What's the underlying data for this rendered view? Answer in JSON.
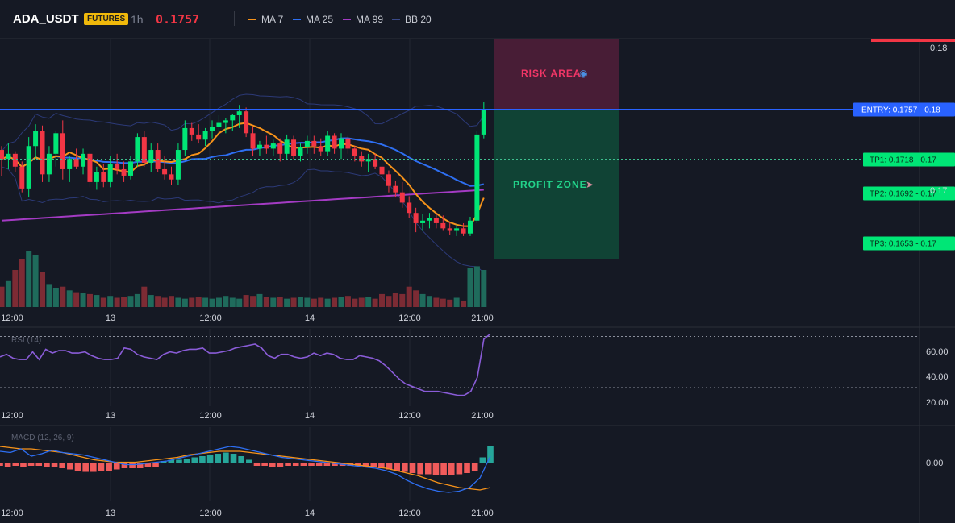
{
  "header": {
    "symbol": "ADA_USDT",
    "badge": "FUTURES",
    "timeframe": "1h",
    "price": "0.1757",
    "legend": [
      {
        "name": "MA 7",
        "color": "#f7931a"
      },
      {
        "name": "MA 25",
        "color": "#2e6ff2"
      },
      {
        "name": "MA 99",
        "color": "#a43bc4"
      },
      {
        "name": "BB 20",
        "color": "#3a4a8a"
      }
    ]
  },
  "overlays": {
    "risk_label": "RISK AREA",
    "profit_label": "PROFIT ZONE",
    "risk_icon": "shield-icon",
    "profit_icon": "rocket-icon"
  },
  "levels": [
    {
      "label": "ENTRY: 0.1757",
      "value": "0.18",
      "price": 0.1757,
      "color": "#2962ff"
    },
    {
      "label": "TP1: 0.1718",
      "value": "0.17",
      "price": 0.1718,
      "color": "#00e676"
    },
    {
      "label": "TP2: 0.1692",
      "value": "0.17",
      "price": 0.1692,
      "color": "#00e676"
    },
    {
      "label": "TP3: 0.1653",
      "value": "0.17",
      "price": 0.1653,
      "color": "#00e676"
    }
  ],
  "colors": {
    "up": "#00e676",
    "down": "#f23645",
    "bg": "#151924"
  },
  "chart_data": [
    {
      "type": "candlestick",
      "title": "",
      "price_axis_ticks": [
        "0.18",
        "0.17"
      ],
      "time_axis_ticks": [
        "12:00",
        "13",
        "12:00",
        "14",
        "12:00",
        "21:00"
      ],
      "ohlc": [
        [
          0.1725,
          0.1728,
          0.1705,
          0.1718
        ],
        [
          0.1718,
          0.173,
          0.171,
          0.1722
        ],
        [
          0.1722,
          0.1724,
          0.1708,
          0.1712
        ],
        [
          0.1712,
          0.1716,
          0.1692,
          0.1695
        ],
        [
          0.1695,
          0.1735,
          0.1688,
          0.1728
        ],
        [
          0.1728,
          0.1745,
          0.1718,
          0.174
        ],
        [
          0.174,
          0.1744,
          0.17,
          0.1706
        ],
        [
          0.1706,
          0.1728,
          0.17,
          0.1722
        ],
        [
          0.1722,
          0.174,
          0.1712,
          0.1738
        ],
        [
          0.1738,
          0.1748,
          0.1702,
          0.171
        ],
        [
          0.171,
          0.172,
          0.17,
          0.1718
        ],
        [
          0.1718,
          0.1726,
          0.171,
          0.1712
        ],
        [
          0.1712,
          0.1726,
          0.1706,
          0.1722
        ],
        [
          0.1722,
          0.1724,
          0.1696,
          0.17
        ],
        [
          0.17,
          0.1712,
          0.1694,
          0.1708
        ],
        [
          0.1708,
          0.1714,
          0.1696,
          0.17
        ],
        [
          0.17,
          0.172,
          0.1696,
          0.1714
        ],
        [
          0.1714,
          0.1722,
          0.1706,
          0.171
        ],
        [
          0.171,
          0.1716,
          0.17,
          0.1705
        ],
        [
          0.1705,
          0.172,
          0.1702,
          0.1716
        ],
        [
          0.1716,
          0.1738,
          0.1712,
          0.1735
        ],
        [
          0.1735,
          0.174,
          0.1712,
          0.1715
        ],
        [
          0.1715,
          0.173,
          0.1708,
          0.1725
        ],
        [
          0.1725,
          0.173,
          0.1708,
          0.171
        ],
        [
          0.171,
          0.172,
          0.1702,
          0.1706
        ],
        [
          0.1706,
          0.1712,
          0.1698,
          0.1702
        ],
        [
          0.1702,
          0.173,
          0.1698,
          0.1725
        ],
        [
          0.1725,
          0.1748,
          0.172,
          0.1742
        ],
        [
          0.1742,
          0.1746,
          0.1732,
          0.1737
        ],
        [
          0.1737,
          0.1745,
          0.173,
          0.1733
        ],
        [
          0.1733,
          0.1742,
          0.1728,
          0.174
        ],
        [
          0.174,
          0.1748,
          0.1734,
          0.1743
        ],
        [
          0.1743,
          0.1752,
          0.1736,
          0.1746
        ],
        [
          0.1746,
          0.175,
          0.1738,
          0.1748
        ],
        [
          0.1748,
          0.1753,
          0.174,
          0.1752
        ],
        [
          0.1752,
          0.176,
          0.1742,
          0.1755
        ],
        [
          0.1755,
          0.1758,
          0.1735,
          0.1738
        ],
        [
          0.1738,
          0.1743,
          0.172,
          0.1726
        ],
        [
          0.1726,
          0.1732,
          0.172,
          0.1729
        ],
        [
          0.1729,
          0.1736,
          0.1722,
          0.1726
        ],
        [
          0.1726,
          0.1733,
          0.172,
          0.173
        ],
        [
          0.173,
          0.1734,
          0.1716,
          0.1722
        ],
        [
          0.1722,
          0.1737,
          0.1717,
          0.1733
        ],
        [
          0.1733,
          0.1736,
          0.1718,
          0.172
        ],
        [
          0.172,
          0.173,
          0.1716,
          0.1727
        ],
        [
          0.1727,
          0.1736,
          0.1722,
          0.1732
        ],
        [
          0.1732,
          0.1736,
          0.1722,
          0.1728
        ],
        [
          0.1728,
          0.1734,
          0.172,
          0.1724
        ],
        [
          0.1724,
          0.174,
          0.172,
          0.1736
        ],
        [
          0.1736,
          0.1738,
          0.1722,
          0.1726
        ],
        [
          0.1726,
          0.1738,
          0.1718,
          0.1734
        ],
        [
          0.1734,
          0.1736,
          0.1722,
          0.1726
        ],
        [
          0.1726,
          0.1728,
          0.1716,
          0.172
        ],
        [
          0.172,
          0.1724,
          0.1712,
          0.1716
        ],
        [
          0.1716,
          0.1722,
          0.1708,
          0.1718
        ],
        [
          0.1718,
          0.1722,
          0.171,
          0.1712
        ],
        [
          0.1712,
          0.1714,
          0.1702,
          0.1706
        ],
        [
          0.1706,
          0.1709,
          0.1692,
          0.1697
        ],
        [
          0.1697,
          0.1701,
          0.1688,
          0.1692
        ],
        [
          0.1692,
          0.17,
          0.168,
          0.1684
        ],
        [
          0.1684,
          0.1689,
          0.1672,
          0.1676
        ],
        [
          0.1676,
          0.168,
          0.1661,
          0.1668
        ],
        [
          0.1668,
          0.1675,
          0.1662,
          0.167
        ],
        [
          0.167,
          0.1676,
          0.1664,
          0.1672
        ],
        [
          0.1672,
          0.1676,
          0.1664,
          0.1668
        ],
        [
          0.1668,
          0.1674,
          0.1662,
          0.1664
        ],
        [
          0.1664,
          0.1669,
          0.1659,
          0.1662
        ],
        [
          0.1662,
          0.1667,
          0.1658,
          0.1664
        ],
        [
          0.1664,
          0.1668,
          0.1658,
          0.166
        ],
        [
          0.166,
          0.1673,
          0.1658,
          0.167
        ],
        [
          0.167,
          0.174,
          0.1668,
          0.1737
        ],
        [
          0.1737,
          0.1762,
          0.1734,
          0.1757
        ]
      ],
      "volume": [
        22,
        28,
        40,
        52,
        60,
        56,
        38,
        24,
        20,
        22,
        18,
        16,
        15,
        14,
        13,
        10,
        12,
        10,
        11,
        12,
        14,
        22,
        13,
        12,
        10,
        12,
        10,
        9,
        10,
        11,
        10,
        9,
        10,
        12,
        10,
        9,
        13,
        12,
        14,
        11,
        10,
        11,
        9,
        10,
        11,
        10,
        9,
        10,
        9,
        10,
        11,
        12,
        9,
        10,
        11,
        9,
        14,
        12,
        15,
        14,
        22,
        18,
        14,
        12,
        10,
        9,
        8,
        10,
        7,
        42,
        44,
        40
      ]
    },
    {
      "type": "line",
      "title": "RSI (14)",
      "levels": [
        70,
        30
      ],
      "ticks": [
        "60.00",
        "40.00",
        "20.00"
      ],
      "ylim": [
        18,
        76
      ],
      "values": [
        54,
        56,
        53,
        52,
        52,
        58,
        52,
        60,
        57,
        59,
        59,
        57,
        57,
        58,
        55,
        53,
        52,
        52,
        53,
        61,
        60,
        56,
        54,
        53,
        52,
        56,
        58,
        57,
        59,
        60,
        60,
        61,
        57,
        57,
        58,
        59,
        61,
        62,
        63,
        64,
        61,
        55,
        53,
        56,
        56,
        54,
        53,
        54,
        57,
        55,
        57,
        56,
        53,
        52,
        52,
        55,
        54,
        53,
        51,
        47,
        42,
        37,
        33,
        31,
        29,
        27,
        27,
        27,
        26,
        25,
        24,
        24,
        27,
        38,
        68,
        72
      ]
    },
    {
      "type": "bar",
      "title": "MACD (12, 26, 9)",
      "ticks": [
        "0.00"
      ],
      "ylim": [
        -0.003,
        0.0024
      ],
      "histogram": [
        -0.0002,
        -0.0003,
        -0.0002,
        -0.0003,
        -0.0002,
        -0.0002,
        -0.0003,
        -0.0003,
        -0.0004,
        -0.0005,
        -0.0006,
        -0.0007,
        -0.0007,
        -0.0006,
        -0.0006,
        -0.0005,
        -0.0004,
        -0.0004,
        -0.0004,
        -0.0003,
        -0.0003,
        0.0002,
        0.0003,
        0.0003,
        0.0004,
        0.0005,
        0.0006,
        0.0007,
        0.0008,
        0.0009,
        0.0008,
        0.0006,
        0.0003,
        -0.0002,
        -0.0002,
        -0.0003,
        -0.0003,
        -0.0002,
        -0.0002,
        -0.0002,
        -0.0002,
        -0.0002,
        -0.0002,
        -0.0002,
        -0.0002,
        -0.0002,
        -0.0002,
        -0.0003,
        -0.0003,
        -0.0004,
        -0.0005,
        -0.0006,
        -0.0007,
        -0.0008,
        -0.0009,
        -0.0009,
        -0.001,
        -0.001,
        -0.001,
        -0.0009,
        -0.0008,
        -0.0006,
        0.0005,
        0.0014
      ],
      "macd": [
        0.001,
        0.0009,
        0.0012,
        0.0006,
        0.0008,
        0.0011,
        0.0009,
        0.0008,
        0.0007,
        0.0005,
        0.0003,
        0.0001,
        -0.0001,
        -0.0001,
        0.0,
        0.0001,
        0.0002,
        0.0004,
        0.0006,
        0.0008,
        0.001,
        0.0012,
        0.0014,
        0.0013,
        0.0011,
        0.0009,
        0.0007,
        0.0005,
        0.0004,
        0.0003,
        0.0002,
        0.0001,
        0.0,
        -0.0001,
        -0.0002,
        -0.0003,
        -0.0004,
        -0.0006,
        -0.0009,
        -0.0014,
        -0.0018,
        -0.0021,
        -0.0023,
        -0.0024,
        -0.0023,
        -0.002,
        -0.0012,
        0.0006
      ],
      "signal": [
        0.0014,
        0.0013,
        0.0012,
        0.0012,
        0.0011,
        0.001,
        0.0009,
        0.0007,
        0.0005,
        0.0003,
        0.0002,
        0.0001,
        0.0001,
        0.0001,
        0.0002,
        0.0003,
        0.0004,
        0.0005,
        0.0007,
        0.0008,
        0.0009,
        0.001,
        0.001,
        0.001,
        0.0009,
        0.0008,
        0.0007,
        0.0006,
        0.0005,
        0.0004,
        0.0003,
        0.0002,
        0.0001,
        0.0,
        -0.0001,
        -0.0002,
        -0.0003,
        -0.0004,
        -0.0006,
        -0.0008,
        -0.001,
        -0.0013,
        -0.0016,
        -0.0018,
        -0.002,
        -0.0021,
        -0.0022,
        -0.002
      ]
    }
  ]
}
